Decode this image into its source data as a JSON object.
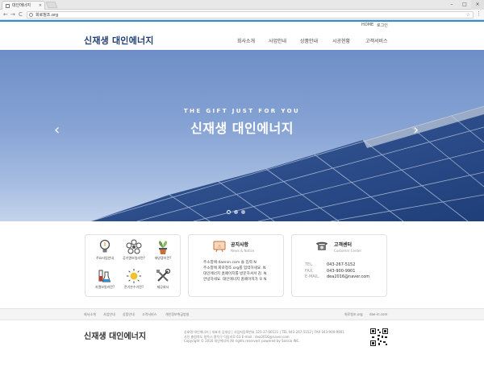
{
  "browser": {
    "tab_title": "대인에너지",
    "tab_close": "×",
    "url": "회로청조.org",
    "window_controls": [
      "–",
      "□",
      "×"
    ],
    "back_glyph": "←",
    "forward_glyph": "→",
    "reload_glyph": "C",
    "menu_glyph": "⋮",
    "star_glyph": "☆"
  },
  "header": {
    "util_links": [
      "HOME",
      "로그인"
    ],
    "brand": "신재생 대인에너지",
    "nav": [
      "회사소개",
      "사업안내",
      "상품안내",
      "시공현황",
      "고객서비스"
    ]
  },
  "hero": {
    "eyebrow": "THE GIFT JUST FOR YOU",
    "title": "신재생 대인에너지",
    "prev_glyph": "‹",
    "next_glyph": "›",
    "slide_count": 3,
    "active_slide": 1
  },
  "quick_links": [
    {
      "label": "주요사업안내",
      "icon": "bulb-icon"
    },
    {
      "label": "공기열보일러란?",
      "icon": "fan-icon"
    },
    {
      "label": "태양광이란?",
      "icon": "plant-icon"
    },
    {
      "label": "지열보일러란?",
      "icon": "lab-icon"
    },
    {
      "label": "전기온수기란?",
      "icon": "sun-icon"
    },
    {
      "label": "제공회사",
      "icon": "tools-icon"
    }
  ],
  "notice": {
    "title": "공지사항",
    "subtitle": "News & Notice",
    "items": [
      "주소창에 daenin.com 을 입력 N",
      "주소창에 회로청조.org를 입력하세요. N",
      "대인에너지 홈페이지를 방문하셔서 감. N",
      "안녕하세요. 대인에너지 홈페이지가 오 N"
    ]
  },
  "contact": {
    "title": "고객센터",
    "subtitle": "Customer Center",
    "rows": [
      {
        "label": "TEL.",
        "value": "043-267-5152"
      },
      {
        "label": "FAX.",
        "value": "043-900-9901"
      },
      {
        "label": "E-MAIL.",
        "value": "dea2016@naver.com"
      }
    ]
  },
  "footer": {
    "links": [
      "회사소개",
      "사업안내",
      "상품안내",
      "고객서비스",
      "개인정보취급방침"
    ],
    "right_links": [
      "회로청조.org",
      "dae-in.com"
    ],
    "brand": "신재생 대인에너지",
    "info_lines": [
      "상호명 대인에너지 | 대표자 김대상 | 사업자등록번호 125-27-00121 | TEL 043-267-5152 | FAX 043-900-9901",
      "사진 충청북도 청주시 흥덕구 덕암리로 63 E-mail : dea2016@naver.com",
      "Copyright © 2016 대인에너지 All rights reserved. powered by Sonsio INC."
    ]
  },
  "colors": {
    "accent": "#2f8fd5",
    "brand": "#1e3f73",
    "new_badge": "#e0483b"
  }
}
